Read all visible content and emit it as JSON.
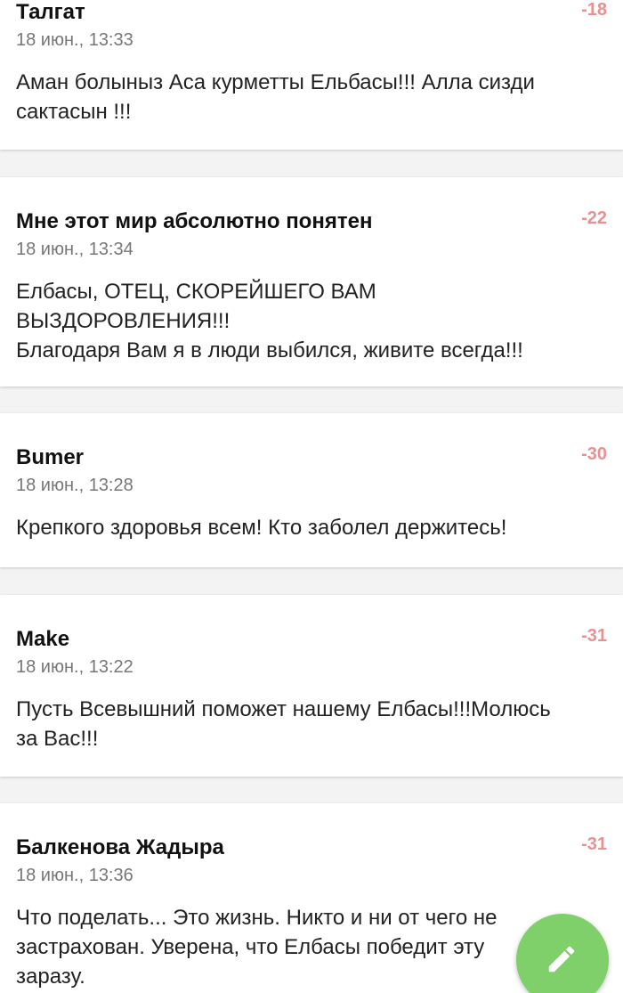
{
  "comments": [
    {
      "author": "Талгат",
      "score": "-18",
      "date": "18 июн., 13:33",
      "lines": [
        "Аман болыныз Аса курметты Ельбасы!!! Алла сизди",
        "сактасын !!!"
      ]
    },
    {
      "author": "Мне этот мир абсолютно понятен",
      "score": "-22",
      "date": "18 июн., 13:34",
      "lines": [
        "Елбасы, ОТЕЦ, СКОРЕЙШЕГО ВАМ",
        "ВЫЗДОРОВЛЕНИЯ!!!",
        "Благодаря Вам я в люди выбился, живите всегда!!!"
      ]
    },
    {
      "author": "Bumer",
      "score": "-30",
      "date": "18 июн., 13:28",
      "lines": [
        "Крепкого здоровья всем! Кто заболел держитесь!"
      ]
    },
    {
      "author": "Make",
      "score": "-31",
      "date": "18 июн., 13:22",
      "lines": [
        "Пусть Всевышний поможет нашему Елбасы!!!Молюсь",
        "за Вас!!!"
      ]
    },
    {
      "author": "Балкенова Жадыра",
      "score": "-31",
      "date": "18 июн., 13:36",
      "lines": [
        "Что поделать... Это жизнь. Никто и ни от чего не",
        "застрахован. Уверена, что Елбасы победит эту",
        "заразу."
      ]
    }
  ],
  "fab": {
    "icon": "pencil-icon",
    "color": "#7fcf6a"
  },
  "colors": {
    "score": "#e89191",
    "background": "#f3f3f3"
  }
}
